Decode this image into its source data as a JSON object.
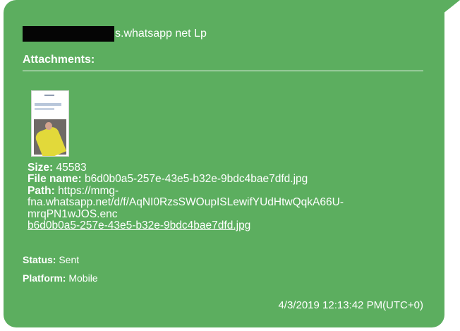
{
  "message": {
    "sender_suffix": "s.whatsapp net Lp",
    "attachments_label": "Attachments:",
    "attachment": {
      "size_label": "Size:",
      "size_value": "45583",
      "file_name_label": "File name:",
      "file_name_value": "b6d0b0a5-257e-43e5-b32e-9bdc4bae7dfd.jpg",
      "path_label": "Path:",
      "path_line1": "https://mmg-",
      "path_line2": "fna.whatsapp.net/d/f/AqNI0RzsSWOupISLewifYUdHtwQqkA66U-",
      "path_line3": "mrqPN1wJOS.enc",
      "path_link": "b6d0b0a5-257e-43e5-b32e-9bdc4bae7dfd.jpg"
    },
    "status_label": "Status:",
    "status_value": "Sent",
    "platform_label": "Platform:",
    "platform_value": "Mobile",
    "timestamp": "4/3/2019 12:13:42 PM(UTC+0)"
  },
  "colors": {
    "bubble": "#5cae5f",
    "text": "#ffffff",
    "redaction": "#050505"
  }
}
